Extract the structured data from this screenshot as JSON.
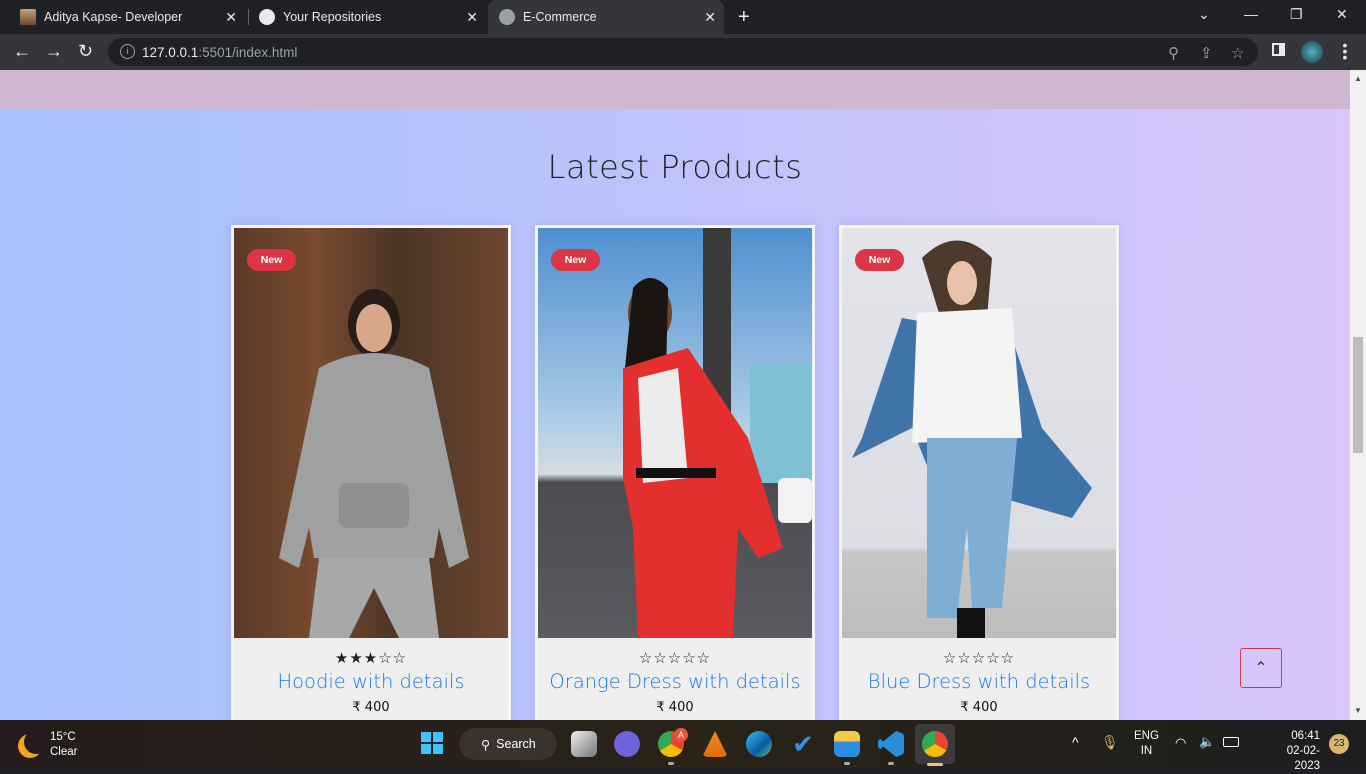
{
  "browser": {
    "tabs": [
      {
        "title": "Aditya Kapse- Developer",
        "icon": "profile-photo-icon",
        "active": false
      },
      {
        "title": "Your Repositories",
        "icon": "github-icon",
        "active": false
      },
      {
        "title": "E-Commerce",
        "icon": "globe-icon",
        "active": true
      }
    ],
    "new_tab_label": "+",
    "url_host": "127.0.0.1",
    "url_rest": ":5501/index.html",
    "close_glyph": "✕"
  },
  "page": {
    "section_title": "Latest Products",
    "products": [
      {
        "badge": "New",
        "rating": 3,
        "max_rating": 5,
        "stars": "★★★☆☆",
        "name": "Hoodie with details",
        "price": "₹ 400",
        "image": "hoodie-model-photo"
      },
      {
        "badge": "New",
        "rating": 0,
        "max_rating": 5,
        "stars": "☆☆☆☆☆",
        "name": "Orange Dress with details",
        "price": "₹ 400",
        "image": "red-suit-model-photo"
      },
      {
        "badge": "New",
        "rating": 0,
        "max_rating": 5,
        "stars": "☆☆☆☆☆",
        "name": "Blue Dress with details",
        "price": "₹ 400",
        "image": "denim-model-photo"
      }
    ],
    "back_to_top_glyph": "⌃",
    "colors": {
      "badge": "#dc3545",
      "product_name": "#1a7ae8",
      "top_band": "#cfb6d1"
    }
  },
  "taskbar": {
    "weather_temp": "15°C",
    "weather_desc": "Clear",
    "search_label": "Search",
    "language_line1": "ENG",
    "language_line2": "IN",
    "time": "06:41",
    "date": "02-02-2023",
    "notification_count": "23",
    "chrome_badge": "A"
  }
}
